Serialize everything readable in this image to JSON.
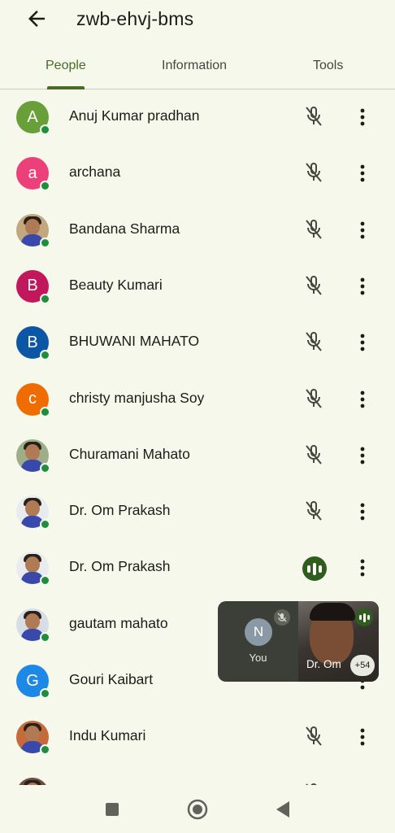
{
  "header": {
    "title": "zwb-ehvj-bms",
    "back_icon": "arrow-back-icon"
  },
  "tabs": [
    {
      "label": "People",
      "active": true
    },
    {
      "label": "Information",
      "active": false
    },
    {
      "label": "Tools",
      "active": false
    }
  ],
  "colors": {
    "accent": "#486b25",
    "presence": "#1e8e3e",
    "background": "#f6f8ec"
  },
  "participants": [
    {
      "name": "Anuj Kumar pradhan",
      "initial": "A",
      "avatar_color": "#689f38",
      "photo": false,
      "mic": "muted"
    },
    {
      "name": "archana",
      "initial": "a",
      "avatar_color": "#ec407a",
      "photo": false,
      "mic": "muted"
    },
    {
      "name": "Bandana Sharma",
      "initial": "",
      "avatar_color": "#c2a77f",
      "photo": true,
      "mic": "muted"
    },
    {
      "name": "Beauty Kumari",
      "initial": "B",
      "avatar_color": "#c2185b",
      "photo": false,
      "mic": "muted"
    },
    {
      "name": "BHUWANI MAHATO",
      "initial": "B",
      "avatar_color": "#0b57a5",
      "photo": false,
      "mic": "muted"
    },
    {
      "name": "christy manjusha Soy",
      "initial": "c",
      "avatar_color": "#ef6c00",
      "photo": false,
      "mic": "muted"
    },
    {
      "name": "Churamani Mahato",
      "initial": "",
      "avatar_color": "#9fae8a",
      "photo": true,
      "mic": "muted"
    },
    {
      "name": "Dr. Om Prakash",
      "initial": "",
      "avatar_color": "#e9ecef",
      "photo": true,
      "mic": "muted"
    },
    {
      "name": "Dr. Om Prakash",
      "initial": "",
      "avatar_color": "#e9ecef",
      "photo": true,
      "mic": "speaking"
    },
    {
      "name": "gautam mahato",
      "initial": "",
      "avatar_color": "#d6dde5",
      "photo": true,
      "mic": "hidden"
    },
    {
      "name": "Gouri Kaibart",
      "initial": "G",
      "avatar_color": "#1e88e5",
      "photo": false,
      "mic": "hidden"
    },
    {
      "name": "Indu Kumari",
      "initial": "",
      "avatar_color": "#c56a3b",
      "photo": true,
      "mic": "muted"
    },
    {
      "name": "",
      "initial": "",
      "avatar_color": "#6d4c41",
      "photo": true,
      "mic": "muted"
    }
  ],
  "pip": {
    "self_initial": "N",
    "self_label": "You",
    "self_mic": "muted",
    "remote_label": "Dr. Om",
    "remote_speaking": true,
    "others_count": "+54"
  },
  "navbar": {
    "recents_icon": "square-icon",
    "home_icon": "circle-home-icon",
    "back_icon": "triangle-back-icon"
  }
}
